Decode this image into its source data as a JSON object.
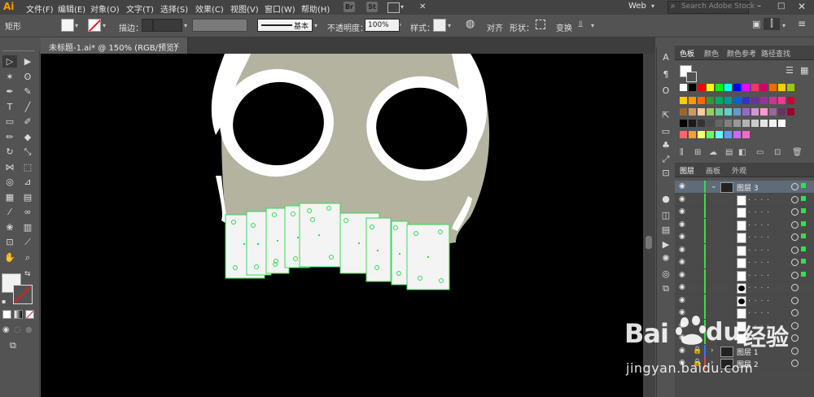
{
  "app": {
    "logo": "Ai",
    "workspace": "Web",
    "search_placeholder": "Search Adobe Stock"
  },
  "menu": [
    "文件(F)",
    "编辑(E)",
    "对象(O)",
    "文字(T)",
    "选择(S)",
    "效果(C)",
    "视图(V)",
    "窗口(W)",
    "帮助(H)"
  ],
  "menu_badges": [
    "Br",
    "St"
  ],
  "control_bar": {
    "tool_name": "矩形",
    "stroke_label": "描边：",
    "stroke_profile": "基本",
    "opacity_label": "不透明度：",
    "opacity_value": "100%",
    "style_label": "样式：",
    "align_label": "对齐",
    "shape_label": "形状：",
    "transform_label": "变换"
  },
  "document_tab": {
    "title": "未标题-1.ai* @ 150% (RGB/预览)",
    "close": "×"
  },
  "tools": [
    {
      "icon": "selection-icon",
      "glyph": "▷"
    },
    {
      "icon": "direct-selection-icon",
      "glyph": "▶"
    },
    {
      "icon": "magic-wand-icon",
      "glyph": "✶"
    },
    {
      "icon": "lasso-icon",
      "glyph": "ʘ"
    },
    {
      "icon": "pen-icon",
      "glyph": "✒"
    },
    {
      "icon": "curvature-icon",
      "glyph": "✎"
    },
    {
      "icon": "type-icon",
      "glyph": "T"
    },
    {
      "icon": "line-icon",
      "glyph": "╱"
    },
    {
      "icon": "rectangle-icon",
      "glyph": "▭"
    },
    {
      "icon": "paintbrush-icon",
      "glyph": "✐"
    },
    {
      "icon": "shaper-icon",
      "glyph": "✏"
    },
    {
      "icon": "eraser-icon",
      "glyph": "◆"
    },
    {
      "icon": "rotate-icon",
      "glyph": "↻"
    },
    {
      "icon": "scale-icon",
      "glyph": "⤡"
    },
    {
      "icon": "width-icon",
      "glyph": "⋈"
    },
    {
      "icon": "free-transform-icon",
      "glyph": "⬚"
    },
    {
      "icon": "shape-builder-icon",
      "glyph": "◎"
    },
    {
      "icon": "perspective-icon",
      "glyph": "⊿"
    },
    {
      "icon": "mesh-icon",
      "glyph": "▦"
    },
    {
      "icon": "gradient-icon",
      "glyph": "▤"
    },
    {
      "icon": "eyedropper-icon",
      "glyph": "⁄"
    },
    {
      "icon": "blend-icon",
      "glyph": "∞"
    },
    {
      "icon": "symbol-sprayer-icon",
      "glyph": "❀"
    },
    {
      "icon": "column-graph-icon",
      "glyph": "▥"
    },
    {
      "icon": "artboard-icon",
      "glyph": "⊡"
    },
    {
      "icon": "slice-icon",
      "glyph": "⟋"
    },
    {
      "icon": "hand-icon",
      "glyph": "✋"
    },
    {
      "icon": "zoom-icon",
      "glyph": "⌕"
    }
  ],
  "panels": {
    "swatch_tabs": [
      "色板",
      "颜色",
      "颜色参考",
      "路径查找"
    ],
    "layers_tabs": [
      "图层",
      "画板",
      "外观"
    ],
    "layers": [
      {
        "name": "图层 3",
        "expanded": true,
        "top": true
      },
      {
        "name": "",
        "kind": "rect"
      },
      {
        "name": "",
        "kind": "rect"
      },
      {
        "name": "",
        "kind": "rect"
      },
      {
        "name": "",
        "kind": "rect"
      },
      {
        "name": "",
        "kind": "rect"
      },
      {
        "name": "",
        "kind": "rect"
      },
      {
        "name": "",
        "kind": "rect"
      },
      {
        "name": "",
        "kind": "ellipse"
      },
      {
        "name": "",
        "kind": "ellipse"
      },
      {
        "name": "",
        "kind": "rect"
      },
      {
        "name": "",
        "kind": "rect"
      },
      {
        "name": "",
        "kind": "rect"
      },
      {
        "name": "图层 1",
        "locked": true
      },
      {
        "name": "图层 2",
        "locked": true
      }
    ]
  },
  "colors": {
    "accent": "#33dd55",
    "skull": "#b3b39f",
    "canvas": "#000000",
    "app_bg": "#535353",
    "menu_bg": "#434343"
  },
  "swatch_colors": [
    [
      "#ffffff",
      "#000000",
      "#ff0000",
      "#ffff00",
      "#00ff00",
      "#00ffff",
      "#0000ff",
      "#ff00ff",
      "#ff3366",
      "#cc0066",
      "#ff6600",
      "#ffcc00",
      "#99cc00"
    ],
    [
      "#ffcc00",
      "#ff9900",
      "#ff6600",
      "#339933",
      "#00aa66",
      "#009999",
      "#0066cc",
      "#3333cc",
      "#663399",
      "#993399",
      "#cc3399",
      "#ff3399",
      "#cc0033"
    ],
    [
      "#996633",
      "#cc9966",
      "#ffcc99",
      "#99cc66",
      "#66cc99",
      "#66cccc",
      "#6699cc",
      "#9966cc",
      "#cc99cc",
      "#ff99cc",
      "#996699",
      "#663366",
      "#990033"
    ],
    [
      "#000000",
      "#1a1a1a",
      "#333333",
      "#4d4d4d",
      "#666666",
      "#808080",
      "#999999",
      "#b3b3b3",
      "#cccccc",
      "#e6e6e6",
      "#f2f2f2",
      "#ffffff"
    ],
    [
      "#ff6666",
      "#ff9933",
      "#ffff66",
      "#66ff66",
      "#66ffff",
      "#6699ff",
      "#cc66ff",
      "#ff66cc"
    ]
  ],
  "watermark": {
    "brand": "Bai",
    "brand_mid": "du",
    "cn": "经验",
    "url": "jingyan.baidu.com"
  }
}
